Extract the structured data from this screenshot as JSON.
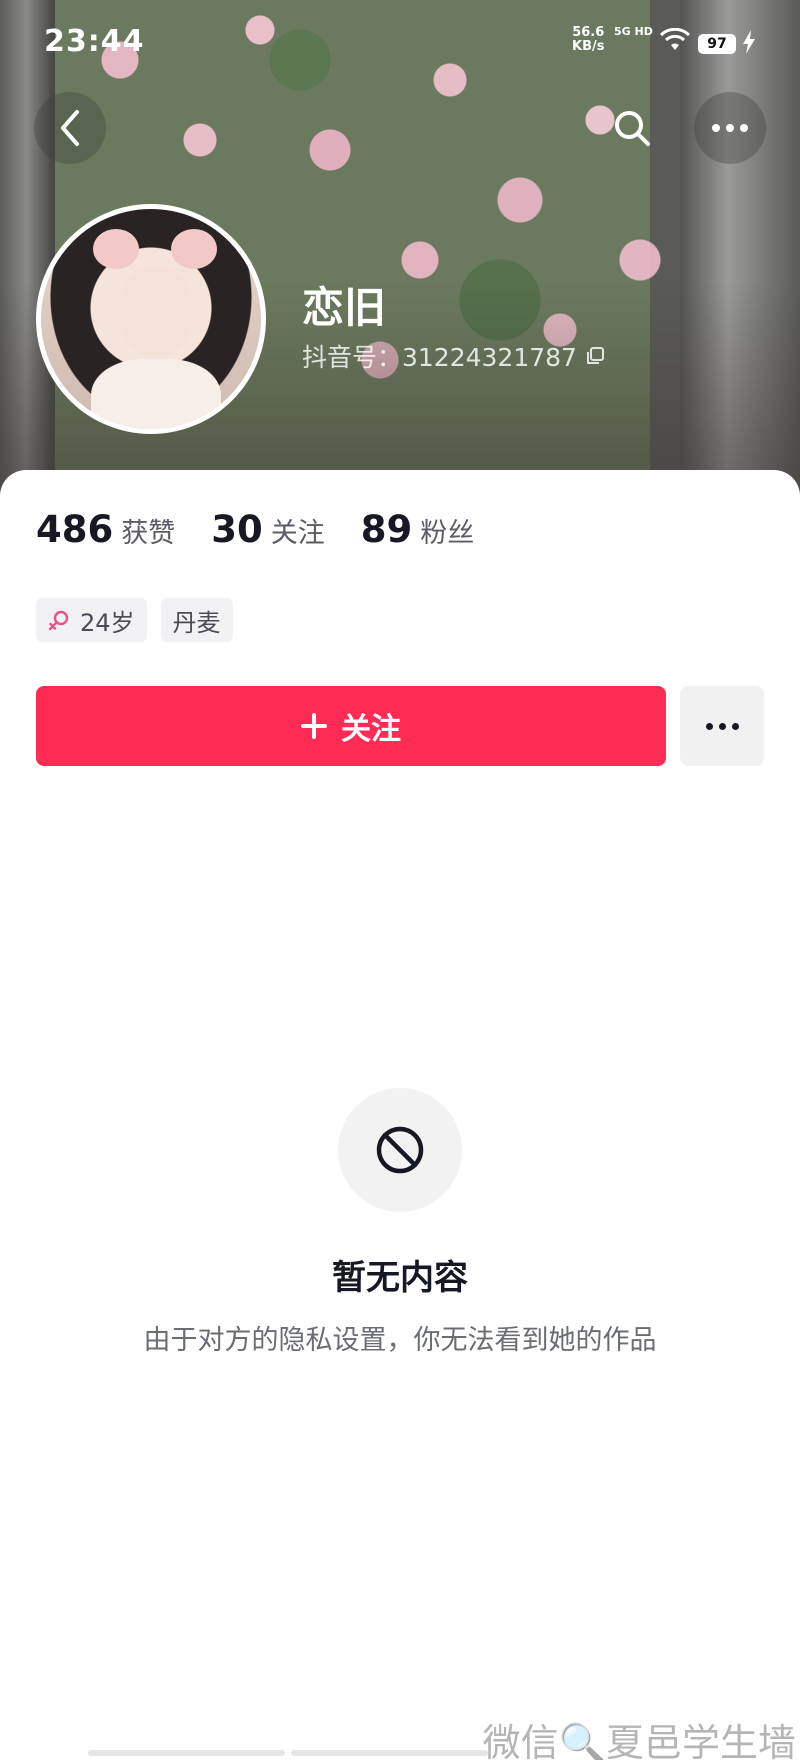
{
  "status_bar": {
    "time": "23:44",
    "network_speed_value": "56.6",
    "network_speed_unit": "KB/s",
    "signal_label": "5G HD",
    "battery": "97"
  },
  "profile": {
    "nickname": "恋旧",
    "douyin_id": "抖音号：31224321787"
  },
  "stats": [
    {
      "value": "486",
      "label": "获赞"
    },
    {
      "value": "30",
      "label": "关注"
    },
    {
      "value": "89",
      "label": "粉丝"
    }
  ],
  "tags": {
    "age": "24岁",
    "location": "丹麦"
  },
  "actions": {
    "follow_label": "关注"
  },
  "empty_state": {
    "title": "暂无内容",
    "description": "由于对方的隐私设置，你无法看到她的作品"
  },
  "watermark": "微信🔍夏邑学生墙",
  "colors": {
    "accent": "#fe2c55",
    "female_icon": "#e8548a"
  },
  "icons": [
    "back-icon",
    "search-icon",
    "more-icon",
    "copy-icon",
    "female-icon",
    "plus-icon",
    "ban-icon",
    "wifi-icon",
    "bolt-icon"
  ]
}
